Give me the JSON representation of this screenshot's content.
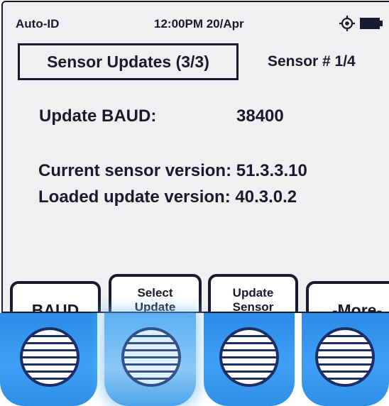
{
  "status_bar": {
    "mode": "Auto-ID",
    "time_date": "12:00PM 20/Apr",
    "gps_icon": "gps-target-icon",
    "battery_icon": "battery-full-icon"
  },
  "header": {
    "title": "Sensor Updates (3/3)",
    "sensor_number": "Sensor # 1/4"
  },
  "content": {
    "baud_label": "Update BAUD:",
    "baud_value": "38400",
    "current_version": "Current sensor version: 51.3.3.10",
    "loaded_version": "Loaded update version: 40.3.0.2"
  },
  "softkeys": {
    "key1": "BAUD",
    "key2_line1": "Select",
    "key2_line2": "Update",
    "key3_line1": "Update",
    "key3_line2": "Sensor",
    "key4": "-More-"
  },
  "hardware_buttons": {
    "pressed_index": 2,
    "color": "#3ea0f5"
  },
  "colors": {
    "text": "#1a1a2e",
    "screen_bg": "#f0f0f2",
    "button_blue": "#3ea0f5"
  }
}
